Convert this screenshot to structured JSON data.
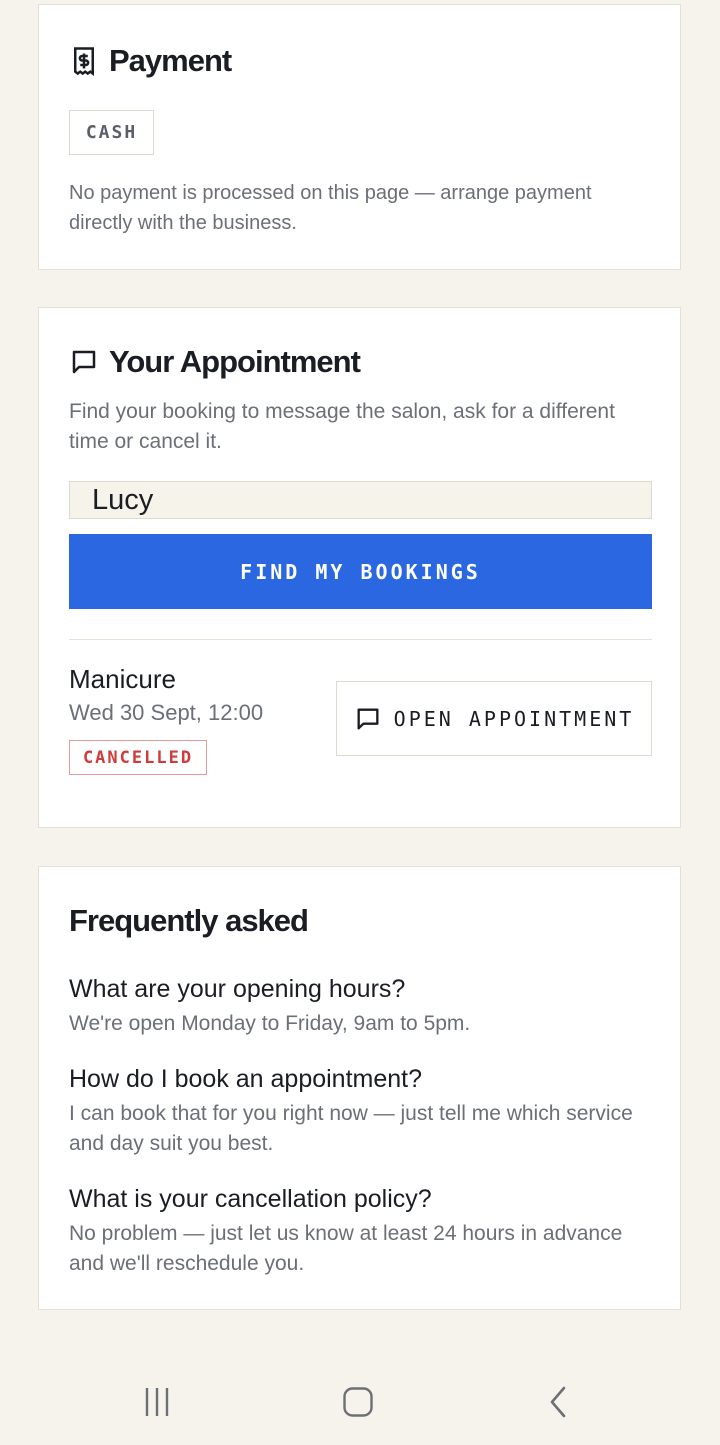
{
  "payment": {
    "title": "Payment",
    "method": "CASH",
    "note": "No payment is processed on this page — arrange payment directly with the business."
  },
  "appointment": {
    "title": "Your Appointment",
    "description": "Find your booking to message the salon, ask for a different time or cancel it.",
    "name_value": "Lucy",
    "find_label": "FIND MY BOOKINGS",
    "booking": {
      "service": "Manicure",
      "datetime": "Wed 30 Sept, 12:00",
      "status": "CANCELLED",
      "open_label": "OPEN APPOINTMENT"
    }
  },
  "faq": {
    "title": "Frequently asked",
    "items": [
      {
        "q": "What are your opening hours?",
        "a": "We're open Monday to Friday, 9am to 5pm."
      },
      {
        "q": "How do I book an appointment?",
        "a": "I can book that for you right now — just tell me which service and day suit you best."
      },
      {
        "q": "What is your cancellation policy?",
        "a": "No problem — just let us know at least 24 hours in advance and we'll reschedule you."
      }
    ]
  },
  "colors": {
    "accent": "#2a67e0",
    "cancelled": "#d23b3b",
    "background": "#f6f3ec"
  },
  "icons": {
    "payment": "receipt-dollar-icon",
    "appointment": "message-square-icon",
    "nav_recent": "recent-apps-icon",
    "nav_home": "home-icon",
    "nav_back": "back-icon"
  }
}
